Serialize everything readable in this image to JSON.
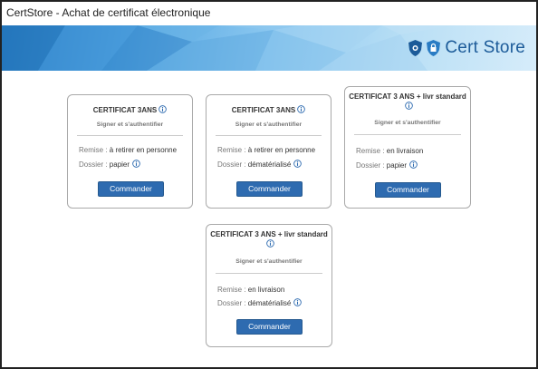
{
  "window": {
    "title": "CertStore - Achat de certificat électronique"
  },
  "header": {
    "logo_word1": "Cert",
    "logo_word2": "Store"
  },
  "colors": {
    "accent": "#2e6bb0",
    "brand": "#1c5b99"
  },
  "cards": [
    {
      "title": "CERTIFICAT 3ANS",
      "subtitle": "Signer et s'authentifier",
      "remise_label": "Remise :",
      "remise_value": "à retirer en personne",
      "dossier_label": "Dossier :",
      "dossier_value": "papier",
      "button": "Commander"
    },
    {
      "title": "CERTIFICAT 3ANS",
      "subtitle": "Signer et s'authentifier",
      "remise_label": "Remise :",
      "remise_value": "à retirer en personne",
      "dossier_label": "Dossier :",
      "dossier_value": "dématérialisé",
      "button": "Commander"
    },
    {
      "title": "CERTIFICAT 3 ANS + livr standard",
      "subtitle": "Signer et s'authentifier",
      "remise_label": "Remise :",
      "remise_value": "en livraison",
      "dossier_label": "Dossier :",
      "dossier_value": "papier",
      "button": "Commander"
    },
    {
      "title": "CERTIFICAT 3 ANS + livr standard",
      "subtitle": "Signer et s'authentifier",
      "remise_label": "Remise :",
      "remise_value": "en livraison",
      "dossier_label": "Dossier :",
      "dossier_value": "dématérialisé",
      "button": "Commander"
    }
  ]
}
